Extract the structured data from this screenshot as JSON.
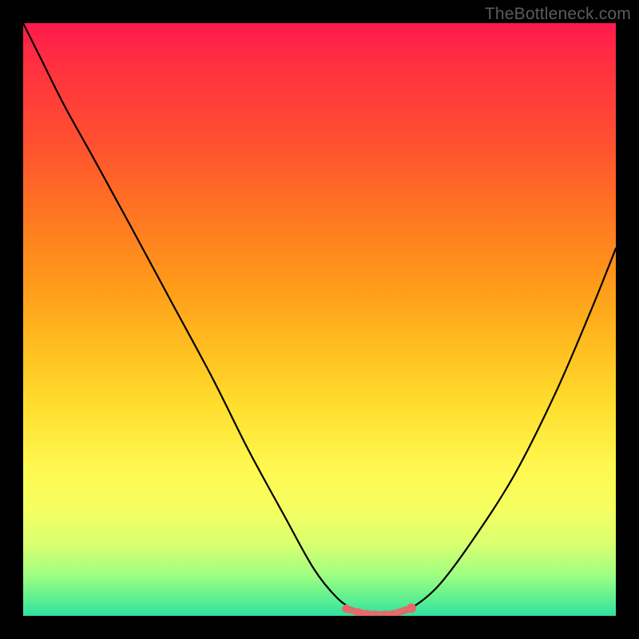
{
  "watermark": "TheBottleneck.com",
  "colors": {
    "background": "#000000",
    "curve_stroke": "#000000",
    "marker_fill": "#e66a6a",
    "gradient_top": "#ff1a4d",
    "gradient_bottom": "#2fe3a0"
  },
  "chart_data": {
    "type": "line",
    "title": "",
    "xlabel": "",
    "ylabel": "",
    "xlim": [
      0,
      100
    ],
    "ylim": [
      0,
      100
    ],
    "x": [
      0,
      3,
      7,
      12,
      18,
      25,
      32,
      38,
      44,
      49,
      53,
      56,
      59,
      62,
      65,
      70,
      76,
      83,
      90,
      96,
      100
    ],
    "values": [
      100,
      94,
      86,
      77,
      66,
      53,
      40,
      28,
      17,
      8,
      3,
      1,
      0,
      0,
      1,
      5,
      13,
      24,
      38,
      52,
      62
    ],
    "markers": {
      "x": [
        54.5,
        56.5,
        58,
        59.5,
        61,
        62.5,
        65.5
      ],
      "y": [
        1.2,
        0.6,
        0.3,
        0.2,
        0.2,
        0.3,
        1.3
      ]
    },
    "annotations": []
  }
}
